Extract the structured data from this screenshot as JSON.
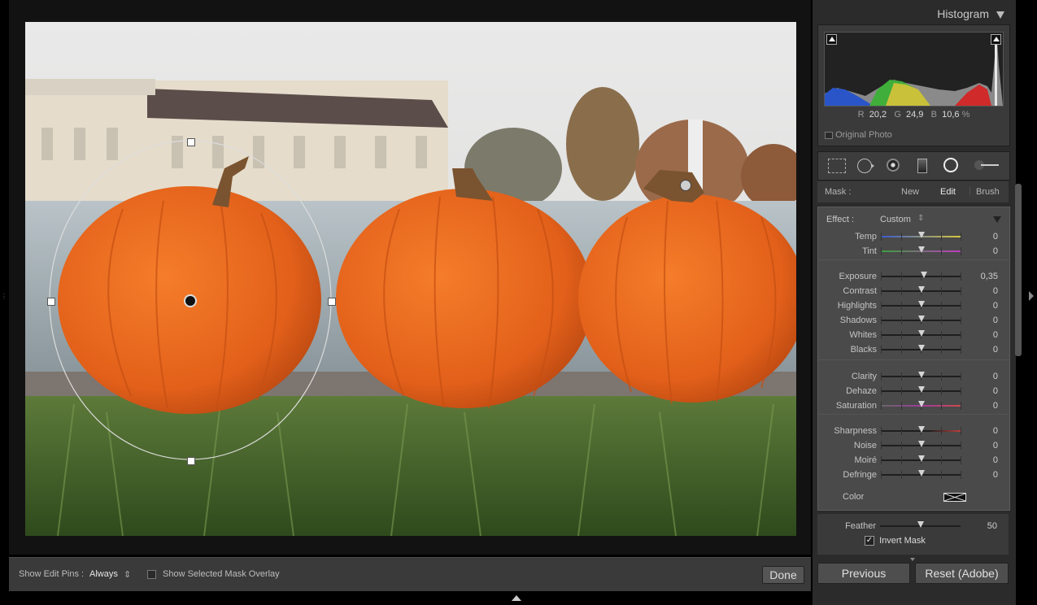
{
  "histogram": {
    "title": "Histogram",
    "r_label": "R",
    "r_value": "20,2",
    "g_label": "G",
    "g_value": "24,9",
    "b_label": "B",
    "b_value": "10,6",
    "pct": "%",
    "original_photo": "Original Photo"
  },
  "mask": {
    "label": "Mask :",
    "new": "New",
    "edit": "Edit",
    "brush": "Brush"
  },
  "effect": {
    "label": "Effect :",
    "preset": "Custom",
    "groups": [
      [
        {
          "label": "Temp",
          "value": "0",
          "pos": 0.5
        },
        {
          "label": "Tint",
          "value": "0",
          "pos": 0.5
        }
      ],
      [
        {
          "label": "Exposure",
          "value": "0,35",
          "pos": 0.535
        },
        {
          "label": "Contrast",
          "value": "0",
          "pos": 0.5
        },
        {
          "label": "Highlights",
          "value": "0",
          "pos": 0.5
        },
        {
          "label": "Shadows",
          "value": "0",
          "pos": 0.5
        },
        {
          "label": "Whites",
          "value": "0",
          "pos": 0.5
        },
        {
          "label": "Blacks",
          "value": "0",
          "pos": 0.5
        }
      ],
      [
        {
          "label": "Clarity",
          "value": "0",
          "pos": 0.5
        },
        {
          "label": "Dehaze",
          "value": "0",
          "pos": 0.5
        },
        {
          "label": "Saturation",
          "value": "0",
          "pos": 0.5
        }
      ],
      [
        {
          "label": "Sharpness",
          "value": "0",
          "pos": 0.5
        },
        {
          "label": "Noise",
          "value": "0",
          "pos": 0.5
        },
        {
          "label": "Moiré",
          "value": "0",
          "pos": 0.5
        },
        {
          "label": "Defringe",
          "value": "0",
          "pos": 0.5
        }
      ]
    ],
    "color_label": "Color"
  },
  "feather": {
    "label": "Feather",
    "value": "50",
    "pos": 0.5
  },
  "invert_mask": "Invert Mask",
  "buttons": {
    "previous": "Previous",
    "reset": "Reset (Adobe)",
    "done": "Done"
  },
  "toolbar": {
    "show_pins_label": "Show Edit Pins :",
    "show_pins_value": "Always",
    "overlay_label": "Show Selected Mask Overlay"
  },
  "colors": {
    "panel": "#2b2b2b",
    "pumpkin": "#e8641a",
    "accent": "#e6e6e6"
  }
}
